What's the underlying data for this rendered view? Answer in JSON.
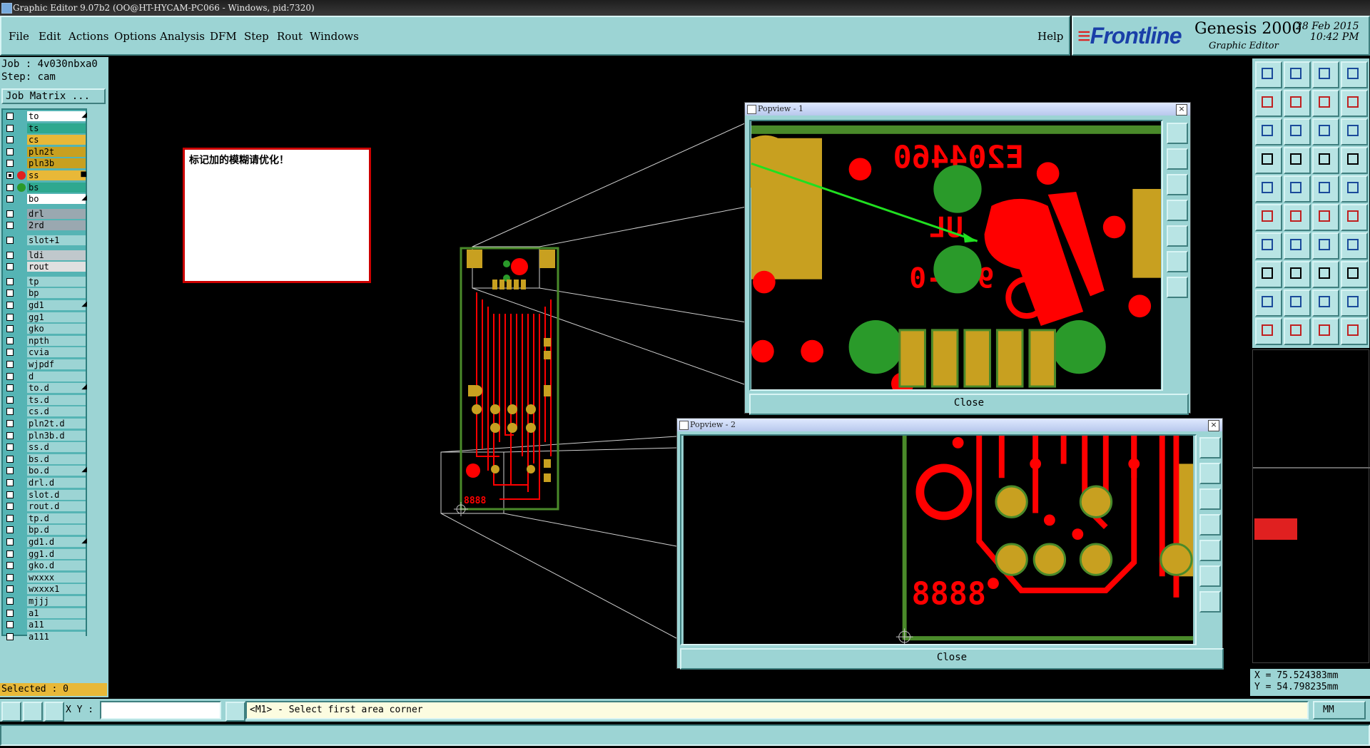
{
  "window": {
    "title": "Graphic Editor 9.07b2 (OO@HT-HYCAM-PC066 - Windows, pid:7320)"
  },
  "menu": {
    "file": "File",
    "edit": "Edit",
    "actions": "Actions",
    "options": "Options",
    "analysis": "Analysis",
    "dfm": "DFM",
    "step": "Step",
    "rout": "Rout",
    "windows": "Windows",
    "help": "Help"
  },
  "brand": {
    "company": "Frontline",
    "product": "Genesis 2000",
    "subtitle": "Graphic Editor",
    "date": "28 Feb 2015",
    "time": "10:42 PM"
  },
  "job": {
    "job_line": "Job : 4v030nbxa0",
    "step_line": "Step: cam",
    "matrix_button": "Job Matrix ..."
  },
  "layers": [
    {
      "name": "to",
      "color": "#ffffff",
      "mark": "◢"
    },
    {
      "name": "ts",
      "color": "#2ea88f"
    },
    {
      "name": "cs",
      "color": "#e8b838"
    },
    {
      "name": "pln2t",
      "color": "#c8a020"
    },
    {
      "name": "pln3b",
      "color": "#c8a020"
    },
    {
      "name": "ss",
      "color": "#e8b838",
      "dot": "#e02020",
      "mark": "■",
      "active": true
    },
    {
      "name": "bs",
      "color": "#2ea88f",
      "dot": "#2a9a2a"
    },
    {
      "name": "bo",
      "color": "#ffffff",
      "mark": "◢"
    },
    {
      "name": "drl",
      "color": "#9aa8b0",
      "gap": true
    },
    {
      "name": "2rd",
      "color": "#9aa8b0"
    },
    {
      "name": "slot+1",
      "color": "#9cd4d4",
      "gap": true
    },
    {
      "name": "ldi",
      "color": "#c0c8cc",
      "gap": true
    },
    {
      "name": "rout",
      "color": "#e0e0e0"
    },
    {
      "name": "tp",
      "color": "#9cd4d4",
      "gap": true
    },
    {
      "name": "bp",
      "color": "#9cd4d4"
    },
    {
      "name": "gd1",
      "color": "#9cd4d4",
      "mark": "◢"
    },
    {
      "name": "gg1",
      "color": "#9cd4d4"
    },
    {
      "name": "gko",
      "color": "#9cd4d4"
    },
    {
      "name": "npth",
      "color": "#9cd4d4"
    },
    {
      "name": "cvia",
      "color": "#9cd4d4"
    },
    {
      "name": "wjpdf",
      "color": "#9cd4d4"
    },
    {
      "name": "d",
      "color": "#9cd4d4"
    },
    {
      "name": "to.d",
      "color": "#9cd4d4",
      "mark": "◢"
    },
    {
      "name": "ts.d",
      "color": "#9cd4d4"
    },
    {
      "name": "cs.d",
      "color": "#9cd4d4"
    },
    {
      "name": "pln2t.d",
      "color": "#9cd4d4"
    },
    {
      "name": "pln3b.d",
      "color": "#9cd4d4"
    },
    {
      "name": "ss.d",
      "color": "#9cd4d4"
    },
    {
      "name": "bs.d",
      "color": "#9cd4d4"
    },
    {
      "name": "bo.d",
      "color": "#9cd4d4",
      "mark": "◢"
    },
    {
      "name": "drl.d",
      "color": "#9cd4d4"
    },
    {
      "name": "slot.d",
      "color": "#9cd4d4"
    },
    {
      "name": "rout.d",
      "color": "#9cd4d4"
    },
    {
      "name": "tp.d",
      "color": "#9cd4d4"
    },
    {
      "name": "bp.d",
      "color": "#9cd4d4"
    },
    {
      "name": "gd1.d",
      "color": "#9cd4d4",
      "mark": "◢"
    },
    {
      "name": "gg1.d",
      "color": "#9cd4d4"
    },
    {
      "name": "gko.d",
      "color": "#9cd4d4"
    },
    {
      "name": "wxxxx",
      "color": "#9cd4d4"
    },
    {
      "name": "wxxxx1",
      "color": "#9cd4d4"
    },
    {
      "name": "mjjj",
      "color": "#9cd4d4"
    },
    {
      "name": "a1",
      "color": "#9cd4d4"
    },
    {
      "name": "a11",
      "color": "#9cd4d4"
    },
    {
      "name": "a111",
      "color": "#9cd4d4"
    }
  ],
  "selected": "Selected : 0",
  "note": {
    "text": "标记加的模糊请优化！"
  },
  "board": {
    "label": "8888",
    "marking": "E204460",
    "ul": "UL",
    "rating": "94V-0"
  },
  "popview1": {
    "title": "Popview - 1",
    "close_label": "Close",
    "close_x": "×"
  },
  "popview2": {
    "title": "Popview - 2",
    "close_label": "Close",
    "close_x": "×"
  },
  "command": {
    "xy_label": "X Y :",
    "xy_value": "",
    "message": "<M1> - Select first area corner",
    "units": "MM"
  },
  "coords": {
    "x": "X = 75.524383mm",
    "y": "Y = 54.798235mm"
  },
  "colors": {
    "panel": "#9cd4d4",
    "copper": "#c8a020",
    "mask": "#2ea88f",
    "silk": "#ff0000",
    "outline": "#4a8a2a"
  }
}
